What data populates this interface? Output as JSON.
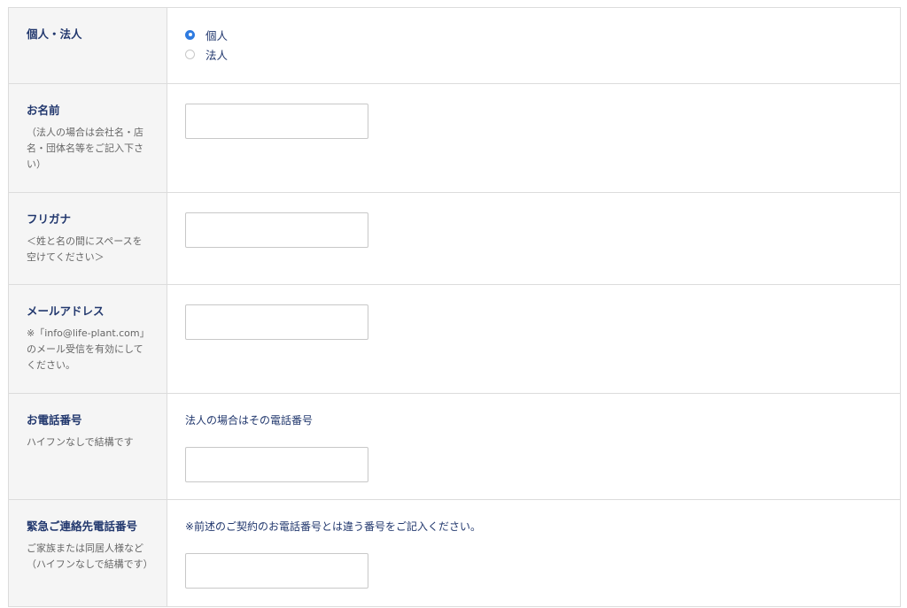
{
  "rows": [
    {
      "label": "個人・法人",
      "options": [
        {
          "label": "個人",
          "selected": true
        },
        {
          "label": "法人",
          "selected": false
        }
      ]
    },
    {
      "label": "お名前",
      "note": "（法人の場合は会社名・店名・団体名等をご記入下さい）",
      "value": ""
    },
    {
      "label": "フリガナ",
      "note": "＜姓と名の間にスペースを空けてください＞",
      "value": ""
    },
    {
      "label": "メールアドレス",
      "note": "※「info@life-plant.com」のメール受信を有効にしてください。",
      "value": ""
    },
    {
      "label": "お電話番号",
      "note": "ハイフンなしで結構です",
      "field_note": "法人の場合はその電話番号",
      "value": ""
    },
    {
      "label": "緊急ご連絡先電話番号",
      "note": "ご家族または同居人様など（ハイフンなしで結構です）",
      "field_note": "※前述のご契約のお電話番号とは違う番号をご記入ください。",
      "value": ""
    }
  ],
  "colors": {
    "label_text": "#22386e",
    "note_text": "#666666",
    "label_bg": "#f5f5f5",
    "border": "#dcdcdc",
    "radio_accent": "#2f7be0"
  }
}
